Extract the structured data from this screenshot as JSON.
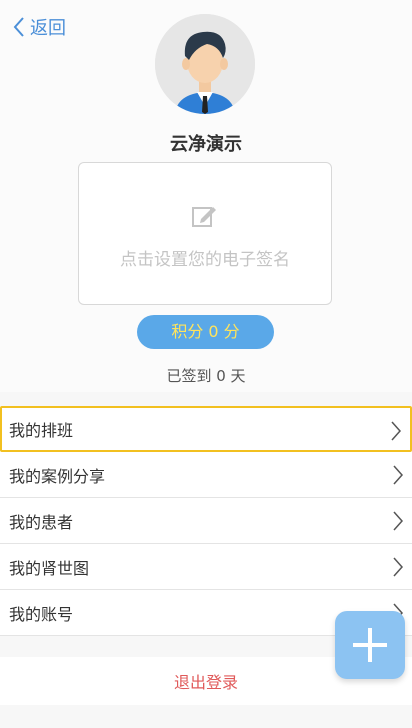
{
  "header": {
    "back_label": "返回",
    "username": "云净演示"
  },
  "signature": {
    "hint": "点击设置您的电子签名"
  },
  "points": {
    "label": "积分 0 分"
  },
  "checkin": {
    "text": "已签到 0 天"
  },
  "menu": {
    "items": [
      {
        "label": "我的排班"
      },
      {
        "label": "我的案例分享"
      },
      {
        "label": "我的患者"
      },
      {
        "label": "我的肾世图"
      },
      {
        "label": "我的账号"
      }
    ]
  },
  "logout": {
    "label": "退出登录"
  },
  "icons": {
    "back": "chevron-left-icon",
    "avatar": "user-avatar",
    "pen": "edit-icon",
    "chevron": "chevron-right-icon",
    "fab": "plus-icon"
  },
  "colors": {
    "accent": "#4b8fd8",
    "points_bg": "#5aa8e8",
    "points_text": "#ffe45c",
    "selected_border": "#f2c020",
    "logout_text": "#e05a5a",
    "fab_bg": "#8cc3f2"
  }
}
